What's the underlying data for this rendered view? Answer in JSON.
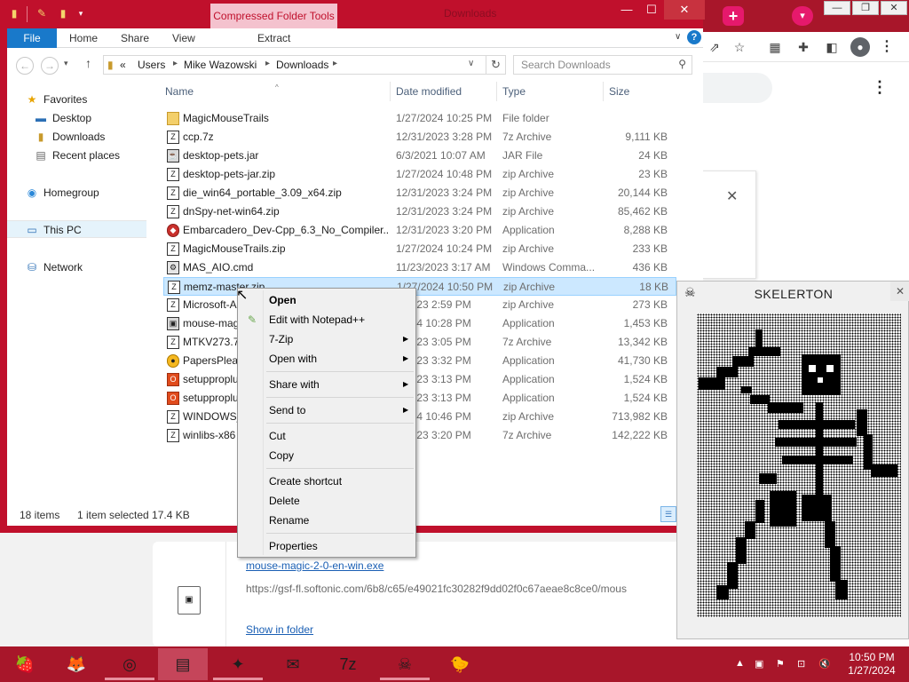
{
  "explorer": {
    "contextual_tab": "Compressed Folder Tools",
    "window_title": "Downloads",
    "ribbon_tabs": [
      "File",
      "Home",
      "Share",
      "View",
      "Extract"
    ],
    "address": {
      "overflow": "«",
      "crumbs": [
        "Users",
        "Mike Wazowski",
        "Downloads"
      ]
    },
    "search_placeholder": "Search Downloads",
    "nav": {
      "favorites": "Favorites",
      "desktop": "Desktop",
      "downloads": "Downloads",
      "recent": "Recent places",
      "homegroup": "Homegroup",
      "thispc": "This PC",
      "network": "Network"
    },
    "columns": {
      "name": "Name",
      "date": "Date modified",
      "type": "Type",
      "size": "Size"
    },
    "files": [
      {
        "name": "MagicMouseTrails",
        "date": "1/27/2024 10:25 PM",
        "type": "File folder",
        "size": ""
      },
      {
        "name": "ccp.7z",
        "date": "12/31/2023 3:28 PM",
        "type": "7z Archive",
        "size": "9,111 KB"
      },
      {
        "name": "desktop-pets.jar",
        "date": "6/3/2021 10:07 AM",
        "type": "JAR File",
        "size": "24 KB"
      },
      {
        "name": "desktop-pets-jar.zip",
        "date": "1/27/2024 10:48 PM",
        "type": "zip Archive",
        "size": "23 KB"
      },
      {
        "name": "die_win64_portable_3.09_x64.zip",
        "date": "12/31/2023 3:24 PM",
        "type": "zip Archive",
        "size": "20,144 KB"
      },
      {
        "name": "dnSpy-net-win64.zip",
        "date": "12/31/2023 3:24 PM",
        "type": "zip Archive",
        "size": "85,462 KB"
      },
      {
        "name": "Embarcadero_Dev-Cpp_6.3_No_Compiler...",
        "date": "12/31/2023 3:20 PM",
        "type": "Application",
        "size": "8,288 KB"
      },
      {
        "name": "MagicMouseTrails.zip",
        "date": "1/27/2024 10:24 PM",
        "type": "zip Archive",
        "size": "233 KB"
      },
      {
        "name": "MAS_AIO.cmd",
        "date": "11/23/2023 3:17 AM",
        "type": "Windows Comma...",
        "size": "436 KB"
      },
      {
        "name": "memz-master.zip",
        "date": "1/27/2024 10:50 PM",
        "type": "zip Archive",
        "size": "18 KB"
      },
      {
        "name": "Microsoft-A",
        "date": "1/2023 2:59 PM",
        "type": "zip Archive",
        "size": "273 KB"
      },
      {
        "name": "mouse-mag",
        "date": "/2024 10:28 PM",
        "type": "Application",
        "size": "1,453 KB"
      },
      {
        "name": "MTKV273.7z",
        "date": "1/2023 3:05 PM",
        "type": "7z Archive",
        "size": "13,342 KB"
      },
      {
        "name": "PapersPleas",
        "date": "1/2023 3:32 PM",
        "type": "Application",
        "size": "41,730 KB"
      },
      {
        "name": "setupproplu",
        "date": "1/2023 3:13 PM",
        "type": "Application",
        "size": "1,524 KB"
      },
      {
        "name": "setupproplu",
        "date": "1/2023 3:13 PM",
        "type": "Application",
        "size": "1,524 KB"
      },
      {
        "name": "WINDOWS_",
        "date": "/2024 10:46 PM",
        "type": "zip Archive",
        "size": "713,982 KB"
      },
      {
        "name": "winlibs-x86",
        "date": "1/2023 3:20 PM",
        "type": "7z Archive",
        "size": "142,222 KB"
      }
    ],
    "status": {
      "count": "18 items",
      "selected": "1 item selected  17.4 KB"
    }
  },
  "context_menu": {
    "open": "Open",
    "notepad": "Edit with Notepad++",
    "sevenzip": "7-Zip",
    "openwith": "Open with",
    "sharewith": "Share with",
    "sendto": "Send to",
    "cut": "Cut",
    "copy": "Copy",
    "shortcut": "Create shortcut",
    "delete": "Delete",
    "rename": "Rename",
    "properties": "Properties"
  },
  "download": {
    "filename": "mouse-magic-2-0-en-win.exe",
    "url": "https://gsf-fl.softonic.com/6b8/c65/e49021fc30282f9dd02f0c67aeae8c8ce0/mous",
    "show": "Show in folder"
  },
  "skelerton": {
    "title": "SKELERTON"
  },
  "taskbar": {
    "time": "10:50 PM",
    "date": "1/27/2024"
  },
  "colors": {
    "accent_red": "#c0102c",
    "taskbar_red": "#a8162a",
    "selection": "#cce8ff",
    "link_blue": "#1a5fb4"
  }
}
